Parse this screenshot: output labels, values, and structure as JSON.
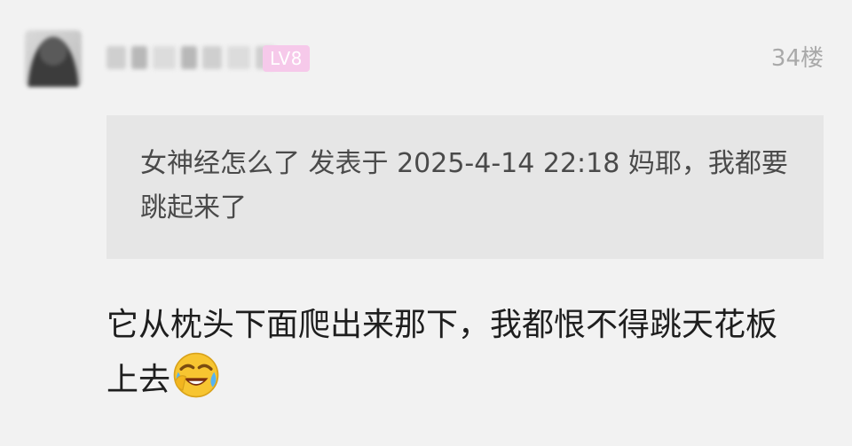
{
  "post": {
    "user": {
      "level": "LV8"
    },
    "floor": "34楼",
    "quote": {
      "text": "女神经怎么了 发表于 2025-4-14 22:18 妈耶，我都要跳起来了"
    },
    "content": {
      "text": "它从枕头下面爬出来那下，我都恨不得跳天花板上去"
    },
    "emoji": {
      "icon": "laughing-tears-emoji-icon"
    }
  }
}
